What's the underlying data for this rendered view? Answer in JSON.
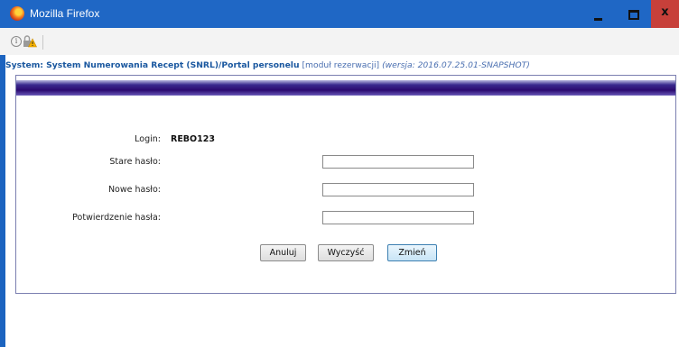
{
  "window": {
    "title": "Mozilla Firefox",
    "close_glyph": "x"
  },
  "navbar": {
    "icons": [
      "info-icon",
      "lock-warning-icon"
    ],
    "info_glyph": "i"
  },
  "header": {
    "system_text": "System: System Numerowania Recept (SNRL)/Portal personelu",
    "module_text": "[moduł rezerwacji]",
    "version_text": "(wersja: 2016.07.25.01-SNAPSHOT)"
  },
  "form": {
    "login_label": "Login:",
    "login_value": "REBO123",
    "old_password_label": "Stare hasło:",
    "old_password_value": "",
    "new_password_label": "Nowe hasło:",
    "new_password_value": "",
    "confirm_password_label": "Potwierdzenie hasła:",
    "confirm_password_value": ""
  },
  "buttons": {
    "cancel": "Anuluj",
    "clear": "Wyczyść",
    "change": "Zmień"
  },
  "colors": {
    "titlebar": "#1f67c5",
    "close_button": "#c7403a",
    "panel_bar": "#2b0a70"
  }
}
